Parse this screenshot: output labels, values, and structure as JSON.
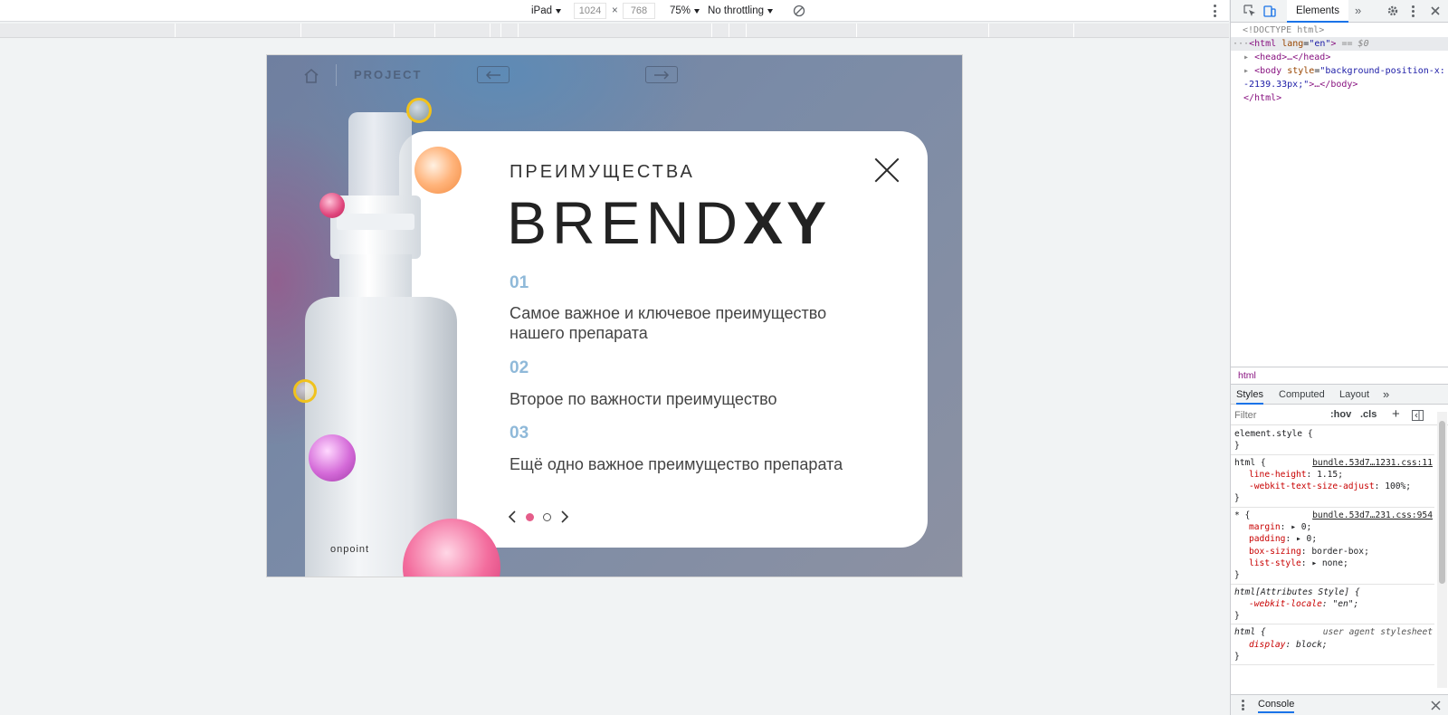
{
  "toolbar": {
    "device": "iPad",
    "width": "1024",
    "times": "×",
    "height": "768",
    "zoom": "75%",
    "throttling": "No throttling"
  },
  "page": {
    "nav_label": "PROJECT",
    "heading_small": "ПРЕИМУЩЕСТВА",
    "brand_light": "BREND",
    "brand_bold": "XY",
    "bottle_logo": "onpoint",
    "items": [
      {
        "num": "01",
        "text": "Самое важное и ключевое преимущество нашего препарата"
      },
      {
        "num": "02",
        "text": "Второе по важности преимущество"
      },
      {
        "num": "03",
        "text": "Ещё одно важное преимущество препарата"
      }
    ],
    "active_slide": 1,
    "slide_count": 2,
    "colors": {
      "accent_pink": "#e55d8a",
      "number_blue": "#8fb9d9"
    }
  },
  "devtools": {
    "tab_elements": "Elements",
    "more_tabs": "»",
    "code": {
      "l1": "<!DOCTYPE html>",
      "l2_open": "<html",
      "l2_attr": "lang",
      "l2_val": "\"en\"",
      "l2_close": ">",
      "l2_eq": "== $0",
      "l3": "<head>…</head>",
      "l4_open": "<body",
      "l4_attr": "style",
      "l4_val": "\"background-position-x:",
      "l5_val": "-2139.33px;\"",
      "l5_rest": ">…</body>",
      "l6": "</html>"
    },
    "breadcrumb": "html",
    "styles_tabs": [
      "Styles",
      "Computed",
      "Layout"
    ],
    "styles_more": "»",
    "filter_placeholder": "Filter",
    "hov": ":hov",
    "cls": ".cls",
    "rules": {
      "r1_sel": "element.style {",
      "close": "}",
      "r2_sel": "html {",
      "r2_src": "bundle.53d7…1231.css:11",
      "r2_p1n": "line-height",
      "r2_p1v": "1.15;",
      "r2_p2n": "-webkit-text-size-adjust",
      "r2_p2v": "100%;",
      "r3_sel": "* {",
      "r3_src": "bundle.53d7…231.css:954",
      "r3_p1n": "margin",
      "r3_p1v": "0;",
      "r3_p2n": "padding",
      "r3_p2v": "0;",
      "r3_p3n": "box-sizing",
      "r3_p3v": "border-box;",
      "r3_p4n": "list-style",
      "r3_p4v": "none;",
      "r4_sel": "html[Attributes Style] {",
      "r4_p1n": "-webkit-locale",
      "r4_p1v": "\"en\";",
      "r5_sel": "html {",
      "r5_src": "user agent stylesheet",
      "r5_p1n": "display",
      "r5_p1v": "block;"
    },
    "console_label": "Console"
  }
}
